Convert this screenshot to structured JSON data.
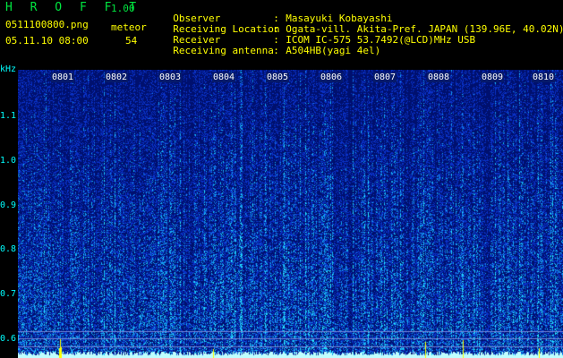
{
  "header": {
    "app_title": "H R O F F T",
    "app_version": "1.00",
    "file_name": "0511100800.png",
    "meteor_label": "meteor",
    "datetime": "05.11.10 08:00",
    "meteor_count": "54"
  },
  "info": [
    {
      "label": "Observer",
      "sep": ":",
      "value": "Masayuki Kobayashi"
    },
    {
      "label": "Receiving Location",
      "sep": ":",
      "value": "Ogata-vill. Akita-Pref. JAPAN (139.96E, 40.02N)"
    },
    {
      "label": "Receiver",
      "sep": ":",
      "value": "ICOM IC-575 53.7492(@LCD)MHz USB"
    },
    {
      "label": "Receiving antenna",
      "sep": ":",
      "value": "A504HB(yagi 4el)"
    }
  ],
  "spectrogram": {
    "unit": "kHz",
    "y_ticks": [
      "1.1",
      "1.0",
      "0.9",
      "0.8",
      "0.7",
      "0.6"
    ],
    "y_range": [
      0.58,
      1.21
    ],
    "time_labels": [
      "0801",
      "0802",
      "0803",
      "0804",
      "0805",
      "0806",
      "0807",
      "0808",
      "0809",
      "0810"
    ],
    "colors": {
      "bg": "#001060",
      "mid": "#0a3cd0",
      "bright": "#2ee0ff",
      "trace": "#c0ffff",
      "meteor": "#ffff00"
    }
  }
}
